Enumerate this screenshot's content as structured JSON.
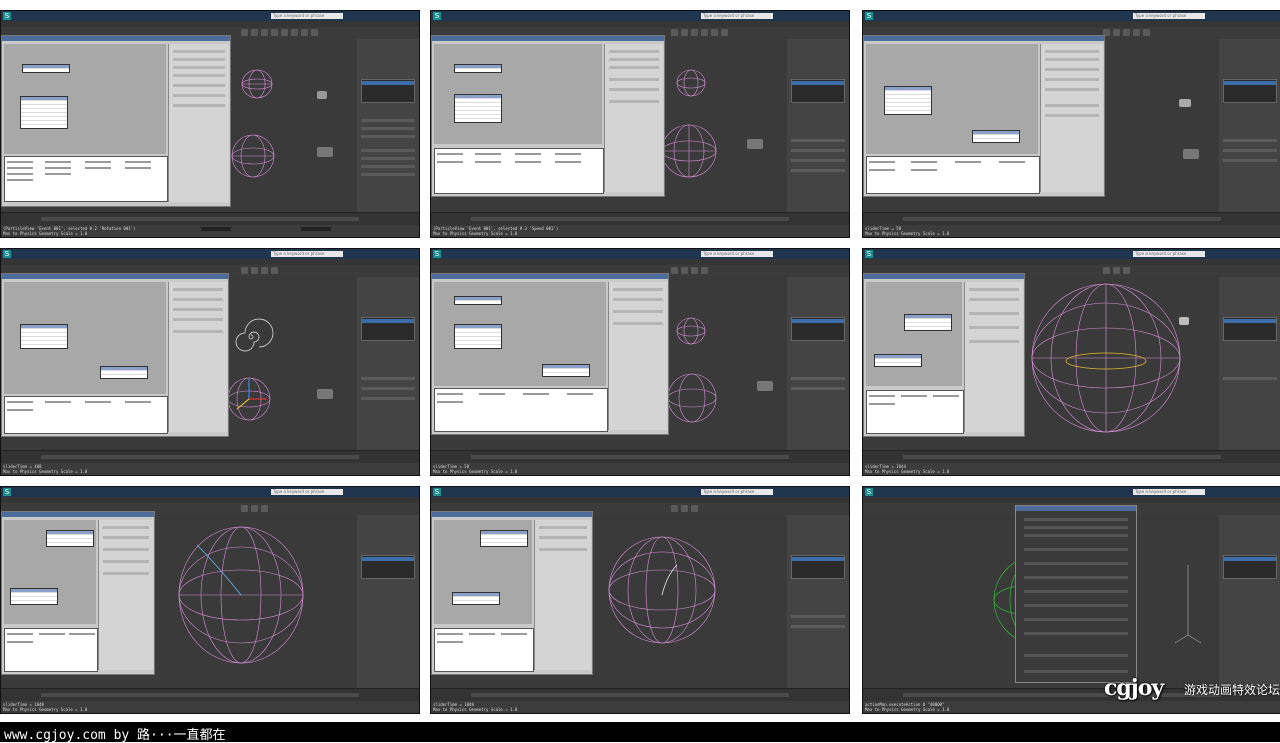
{
  "watermark": {
    "credit_line": "www.cgjoy.com by 路···一直都在",
    "logo": "cgjoy",
    "logo_subtitle": "游戏动画特效论坛"
  },
  "app": {
    "search_placeholder": "Type a keyword or phrase"
  },
  "frames": [
    {
      "status_line1": "(ParticleView 'Event 001', selected #.2 'Rotation 001')",
      "status_line2": "Max to Physics Geometry Scale = 1.0"
    },
    {
      "status_line1": "(ParticleView 'Event 001', selected #.3 'Speed 001')",
      "status_line2": "Max to Physics Geometry Scale = 1.0"
    },
    {
      "status_line1": "sliderTime = 58",
      "status_line2": "Max to Physics Geometry Scale = 1.0"
    },
    {
      "status_line1": "sliderTime = 408",
      "status_line2": "Max to Physics Geometry Scale = 1.0"
    },
    {
      "status_line1": "sliderTime = 58",
      "status_line2": "Max to Physics Geometry Scale = 1.0"
    },
    {
      "status_line1": "sliderTime = 1044",
      "status_line2": "Max to Physics Geometry Scale = 1.0"
    },
    {
      "status_line1": "sliderTime = 1048",
      "status_line2": "Max to Physics Geometry Scale = 1.0"
    },
    {
      "status_line1": "sliderTime = 1048",
      "status_line2": "Max to Physics Geometry Scale = 1.0"
    },
    {
      "status_line1": "actionMan.executeAction 0 \"40000\"",
      "status_line2": "Max to Physics Geometry Scale = 1.0"
    }
  ],
  "colors": {
    "viewport_bg": "#3a3a3a",
    "sphere_wire": "#d98fd9",
    "title_bar": "#1f3550",
    "selection": "#3b6ea8"
  }
}
